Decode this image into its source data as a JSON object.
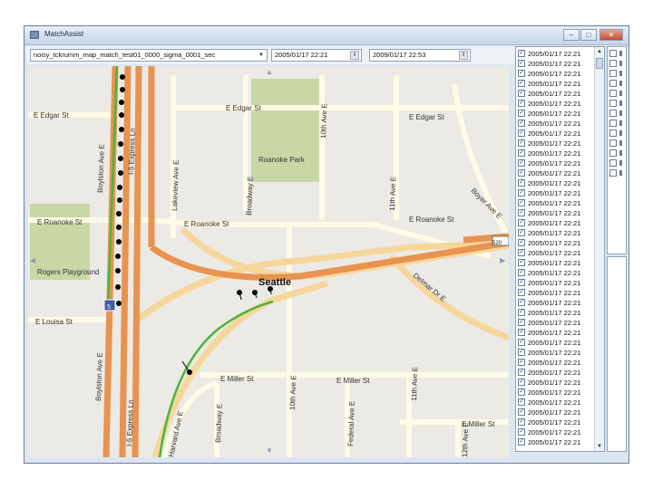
{
  "window": {
    "title": "MatchAssist"
  },
  "toolbar": {
    "file_combo": "noisy_tckrumm_map_match_test01_0000_sigma_0001_sec",
    "start_time": "2005/01/17 22:21",
    "end_time": "2009/01/17 22:53"
  },
  "map": {
    "labels": {
      "e_edgar_st_left": "E Edgar St",
      "e_edgar_st_mid": "E Edgar St",
      "e_edgar_st_right": "E Edgar St",
      "roanoke_park": "Roanoke Park",
      "e_roanoke_st_left": "E Roanoke St",
      "e_roanoke_st_mid": "E Roanoke St",
      "e_roanoke_st_right": "E Roanoke St",
      "rogers_playground": "Rogers Playground",
      "seattle": "Seattle",
      "e_louisa_st": "E Louisa St",
      "e_miller_st_left": "E Miller St",
      "e_miller_st_mid": "E Miller St",
      "e_miller_st_right": "E Miller St",
      "boylston_ave_e_top": "Boylston Ave E",
      "boylston_ave_e_bottom": "Boylston Ave E",
      "i5_express_ln_top": "I-5 Express Ln",
      "i5_express_ln_bottom": "I-5 Express Ln",
      "harvard_ave_e": "Harvard Ave E",
      "lakeview_ave_e": "Lakeview Ave E",
      "broadway_e_top": "Broadway E",
      "broadway_e_bottom": "Broadway E",
      "tenth_ave_e_top": "10th Ave E",
      "tenth_ave_e_bottom": "10th Ave E",
      "eleventh_ave_e_top": "11th Ave E",
      "eleventh_ave_e_bottom": "11th Ave E",
      "federal_ave_e": "Federal Ave E",
      "twelfth_ave_e": "12th Ave E",
      "boyer_ave_e": "Boyer Ave E",
      "delmar_dr_e": "Delmar Dr E",
      "sr520_shield": "520",
      "i5_shield": "5"
    }
  },
  "list": {
    "items": [
      {
        "time": "2005/01/17 22:21",
        "checked": true
      },
      {
        "time": "2005/01/17 22:21",
        "checked": true
      },
      {
        "time": "2005/01/17 22:21",
        "checked": true
      },
      {
        "time": "2005/01/17 22:21",
        "checked": true
      },
      {
        "time": "2005/01/17 22:21",
        "checked": true
      },
      {
        "time": "2005/01/17 22:21",
        "checked": true
      },
      {
        "time": "2005/01/17 22:21",
        "checked": true
      },
      {
        "time": "2005/01/17 22:21",
        "checked": true
      },
      {
        "time": "2005/01/17 22:21",
        "checked": true
      },
      {
        "time": "2005/01/17 22:21",
        "checked": true
      },
      {
        "time": "2005/01/17 22:21",
        "checked": true
      },
      {
        "time": "2005/01/17 22:21",
        "checked": true
      },
      {
        "time": "2005/01/17 22:21",
        "checked": true
      },
      {
        "time": "2005/01/17 22:21",
        "checked": true
      },
      {
        "time": "2005/01/17 22:21",
        "checked": true
      },
      {
        "time": "2005/01/17 22:21",
        "checked": true
      },
      {
        "time": "2005/01/17 22:21",
        "checked": true
      },
      {
        "time": "2005/01/17 22:21",
        "checked": true
      },
      {
        "time": "2005/01/17 22:21",
        "checked": true
      },
      {
        "time": "2005/01/17 22:21",
        "checked": true
      },
      {
        "time": "2005/01/17 22:21",
        "checked": true
      },
      {
        "time": "2005/01/17 22:21",
        "checked": true
      },
      {
        "time": "2005/01/17 22:21",
        "checked": true
      },
      {
        "time": "2005/01/17 22:21",
        "checked": true
      },
      {
        "time": "2005/01/17 22:21",
        "checked": true
      },
      {
        "time": "2005/01/17 22:21",
        "checked": true
      },
      {
        "time": "2005/01/17 22:21",
        "checked": true
      },
      {
        "time": "2005/01/17 22:21",
        "checked": true
      },
      {
        "time": "2005/01/17 22:21",
        "checked": true
      },
      {
        "time": "2005/01/17 22:21",
        "checked": true
      },
      {
        "time": "2005/01/17 22:21",
        "checked": true
      },
      {
        "time": "2005/01/17 22:21",
        "checked": true
      },
      {
        "time": "2005/01/17 22:21",
        "checked": true
      },
      {
        "time": "2005/01/17 22:21",
        "checked": true
      },
      {
        "time": "2005/01/17 22:21",
        "checked": true
      },
      {
        "time": "2005/01/17 22:21",
        "checked": true
      },
      {
        "time": "2005/01/17 22:21",
        "checked": true
      },
      {
        "time": "2005/01/17 22:21",
        "checked": true
      },
      {
        "time": "2005/01/17 22:21",
        "checked": true
      },
      {
        "time": "2005/01/17 22:21",
        "checked": true
      }
    ]
  },
  "colors": {
    "map_bg": "#eceae4",
    "park": "#c9d7a6",
    "road_minor": "#fffbe6",
    "road_major": "#f7d69b",
    "freeway": "#e8934f",
    "matched_route": "#4ab53a",
    "gps_point": "#000000"
  }
}
